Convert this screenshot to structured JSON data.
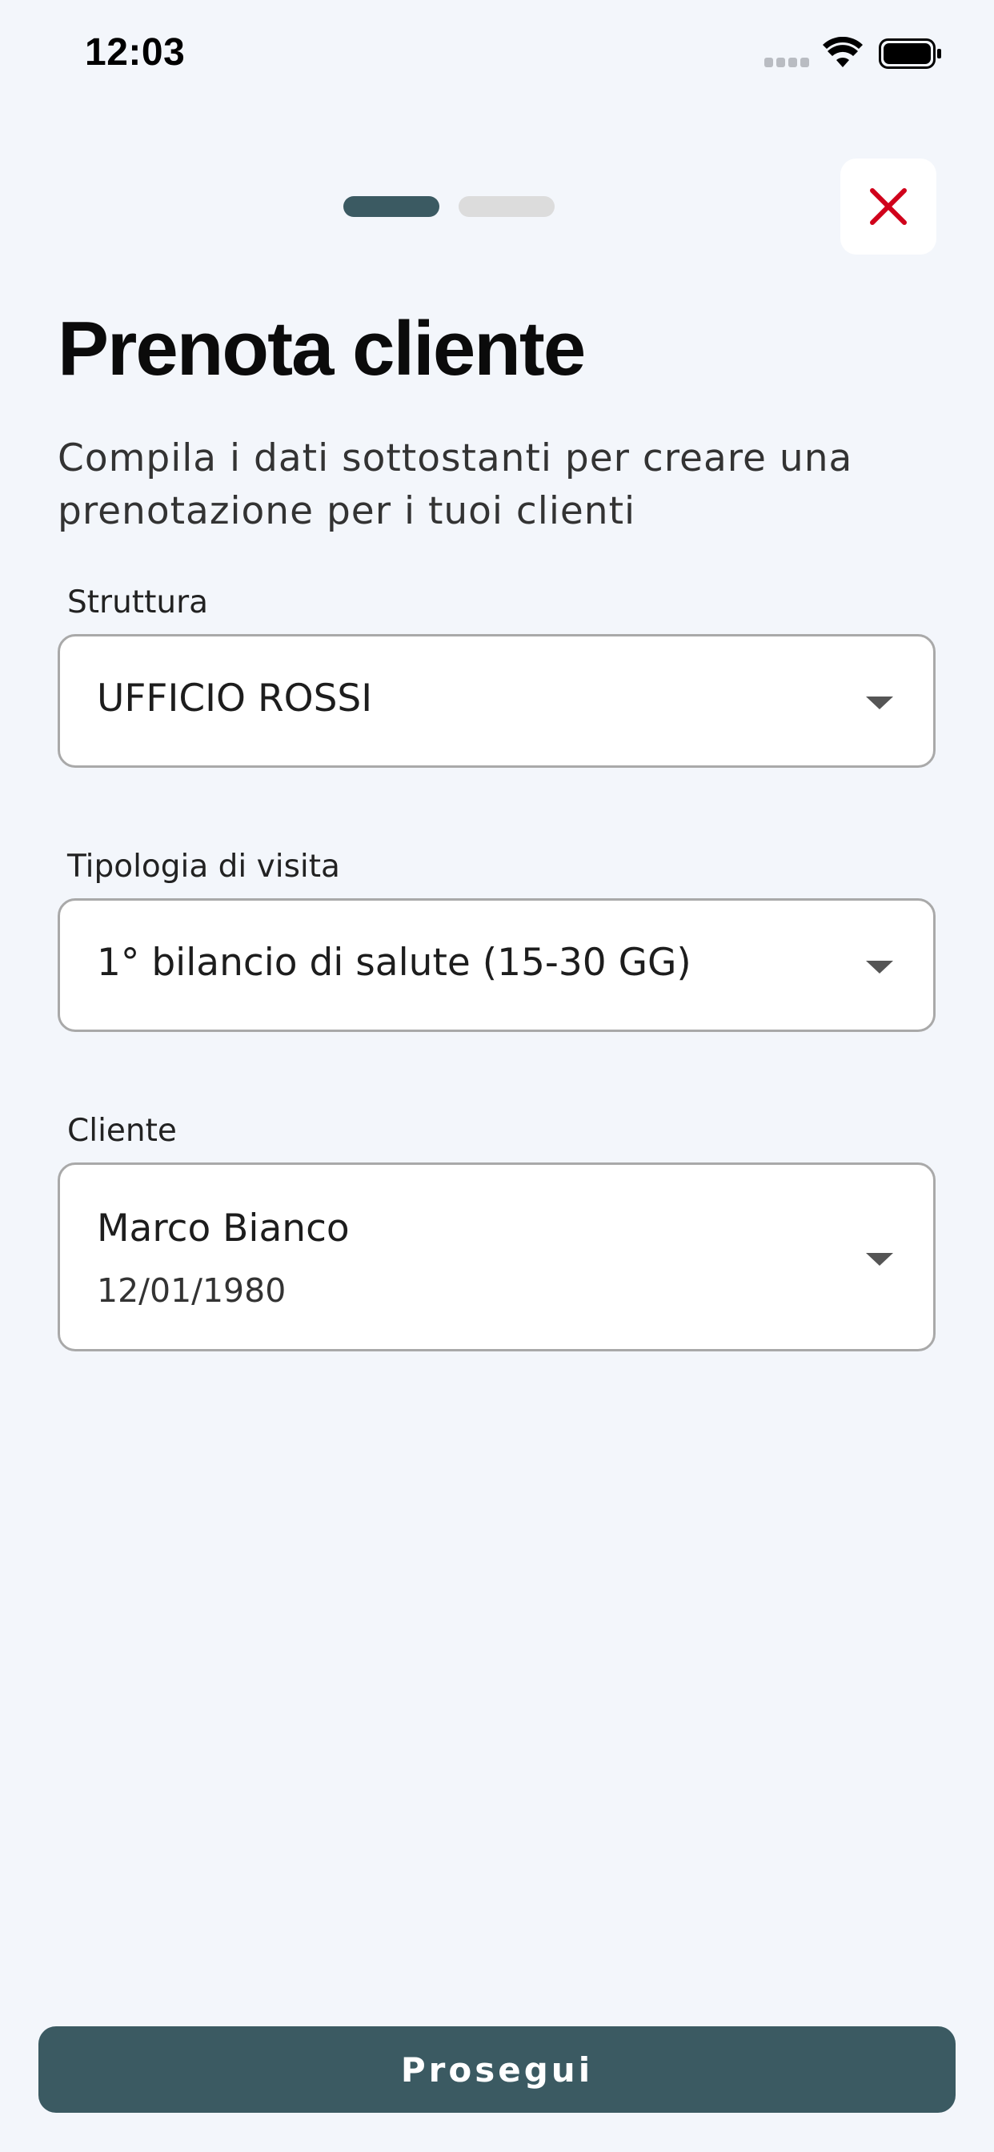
{
  "status_bar": {
    "time": "12:03",
    "icons": [
      "signal-icon",
      "wifi-icon",
      "battery-icon"
    ]
  },
  "progress": {
    "total_steps": 2,
    "current_step": 1
  },
  "header": {
    "close_icon": "close-icon",
    "title": "Prenota cliente",
    "subtitle": "Compila i dati sottostanti per creare una prenotazione per i tuoi clienti"
  },
  "form": {
    "struttura": {
      "label": "Struttura",
      "value": "UFFICIO ROSSI"
    },
    "tipologia": {
      "label": "Tipologia di visita",
      "value": "1° bilancio di salute (15-30 GG)"
    },
    "cliente": {
      "label": "Cliente",
      "name": "Marco Bianco",
      "birthdate": "12/01/1980"
    }
  },
  "footer": {
    "continue_label": "Prosegui"
  },
  "colors": {
    "background": "#f3f6fb",
    "primary": "#3b5a62",
    "close_red": "#d0021b",
    "inactive_step": "#dcdcdc"
  }
}
